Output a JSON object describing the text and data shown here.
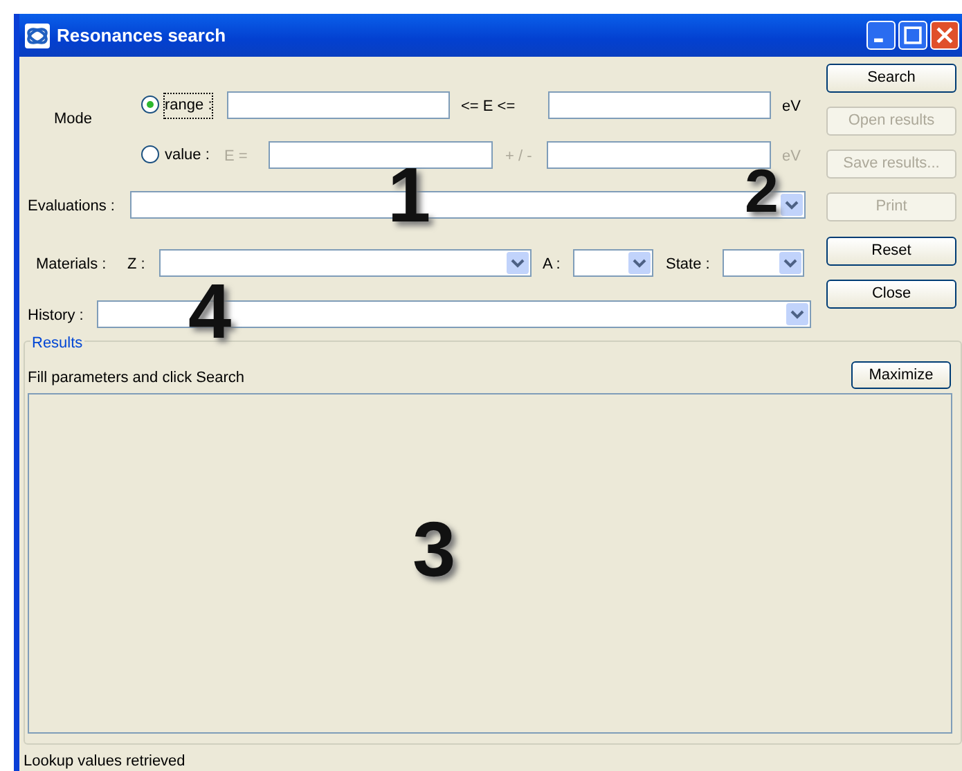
{
  "window": {
    "title": "Resonances search"
  },
  "mode": {
    "label": "Mode",
    "options": [
      {
        "label": "range :",
        "selected": true,
        "op": "<=  E  <=",
        "unit": "eV"
      },
      {
        "label": "value :",
        "selected": false,
        "op": "+ / -",
        "unit": "eV",
        "prefix": "E  ="
      }
    ]
  },
  "evaluations": {
    "label": "Evaluations :"
  },
  "materials": {
    "label": "Materials :",
    "z_label": "Z :",
    "a_label": "A :",
    "state_label": "State :"
  },
  "history": {
    "label": "History :"
  },
  "buttons": [
    {
      "label": "Search",
      "disabled": false
    },
    {
      "label": "Open results",
      "disabled": true
    },
    {
      "label": "Save results...",
      "disabled": true
    },
    {
      "label": "Print",
      "disabled": true
    },
    {
      "label": "Reset",
      "disabled": false
    },
    {
      "label": "Close",
      "disabled": false
    }
  ],
  "results": {
    "legend": "Results",
    "message": "Fill parameters and click Search",
    "maximize": "Maximize"
  },
  "callouts": [
    "1",
    "2",
    "3",
    "4"
  ],
  "status_bar": "Lookup values retrieved"
}
